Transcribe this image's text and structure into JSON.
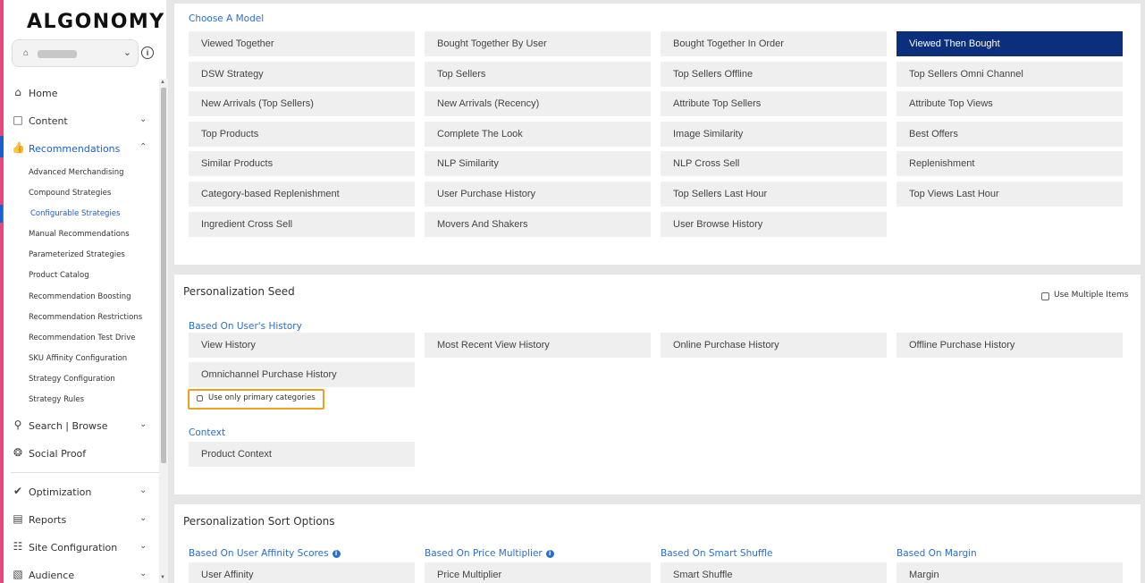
{
  "brand": {
    "logo": "ALGONOMY"
  },
  "store": {
    "icon": "store-icon"
  },
  "nav": {
    "home": "Home",
    "content": "Content",
    "recommendations": "Recommendations",
    "sub_items": [
      "Advanced Merchandising",
      "Compound Strategies",
      "Configurable Strategies",
      "Manual Recommendations",
      "Parameterized Strategies",
      "Product Catalog",
      "Recommendation Boosting",
      "Recommendation Restrictions",
      "Recommendation Test Drive",
      "SKU Affinity Configuration",
      "Strategy Configuration",
      "Strategy Rules"
    ],
    "search_browse": "Search | Browse",
    "social_proof": "Social Proof",
    "optimization": "Optimization",
    "reports": "Reports",
    "site_configuration": "Site Configuration",
    "audience": "Audience"
  },
  "model": {
    "label": "Choose A Model",
    "options": [
      [
        "Viewed Together",
        "Bought Together By User",
        "Bought Together In Order",
        "Viewed Then Bought"
      ],
      [
        "DSW Strategy",
        "Top Sellers",
        "Top Sellers Offline",
        "Top Sellers Omni Channel"
      ],
      [
        "New Arrivals (Top Sellers)",
        "New Arrivals (Recency)",
        "Attribute Top Sellers",
        "Attribute Top Views"
      ],
      [
        "Top Products",
        "Complete The Look",
        "Image Similarity",
        "Best Offers"
      ],
      [
        "Similar Products",
        "NLP Similarity",
        "NLP Cross Sell",
        "Replenishment"
      ],
      [
        "Category-based Replenishment",
        "User Purchase History",
        "Top Sellers Last Hour",
        "Top Views Last Hour"
      ],
      [
        "Ingredient Cross Sell",
        "Movers And Shakers",
        "User Browse History",
        ""
      ]
    ],
    "selected": "Viewed Then Bought"
  },
  "seed": {
    "title": "Personalization Seed",
    "use_multiple_items": "Use Multiple Items",
    "history_label": "Based On User's History",
    "history_options": [
      "View History",
      "Most Recent View History",
      "Online Purchase History",
      "Offline Purchase History",
      "Omnichannel Purchase History"
    ],
    "primary_categories": "Use only primary categories",
    "context_label": "Context",
    "context_option": "Product Context"
  },
  "sort": {
    "title": "Personalization Sort Options",
    "groups": [
      {
        "label": "Based On User Affinity Scores",
        "option": "User Affinity"
      },
      {
        "label": "Based On Price Multiplier",
        "option": "Price Multiplier"
      },
      {
        "label": "Based On Smart Shuffle",
        "option": "Smart Shuffle"
      },
      {
        "label": "Based On Margin",
        "option": "Margin"
      }
    ]
  },
  "colors": {
    "accent": "#2a6fcf",
    "selected": "#0c2f7d",
    "sidebar_edge": "#e8467c",
    "highlight": "#f0a020"
  }
}
